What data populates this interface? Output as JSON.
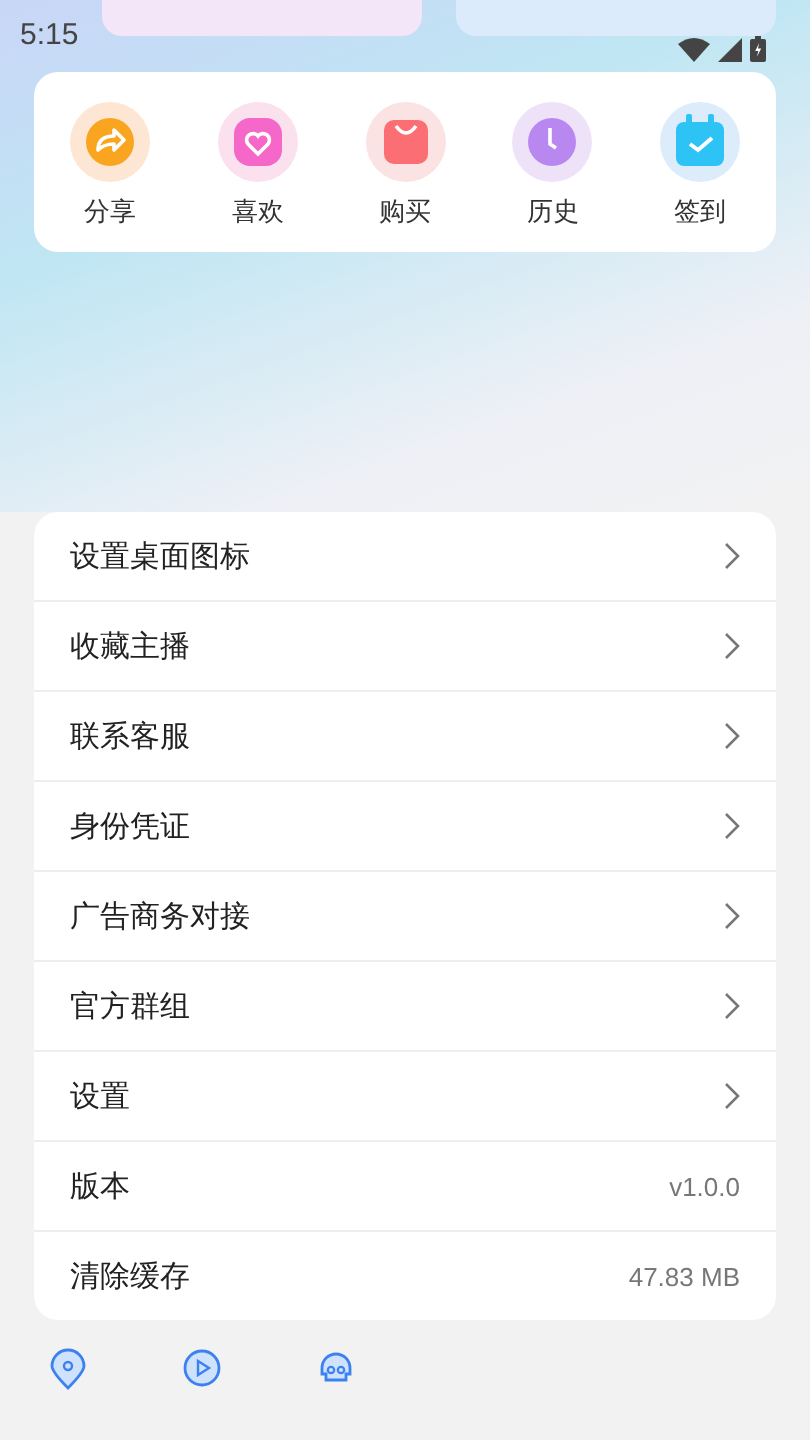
{
  "status_bar": {
    "time": "5:15"
  },
  "quick_actions": [
    {
      "label": "分享"
    },
    {
      "label": "喜欢"
    },
    {
      "label": "购买"
    },
    {
      "label": "历史"
    },
    {
      "label": "签到"
    }
  ],
  "menu": [
    {
      "label": "设置桌面图标",
      "kind": "link"
    },
    {
      "label": "收藏主播",
      "kind": "link"
    },
    {
      "label": "联系客服",
      "kind": "link"
    },
    {
      "label": "身份凭证",
      "kind": "link"
    },
    {
      "label": "广告商务对接",
      "kind": "link"
    },
    {
      "label": "官方群组",
      "kind": "link"
    },
    {
      "label": "设置",
      "kind": "link"
    },
    {
      "label": "版本",
      "kind": "value",
      "value": "v1.0.0"
    },
    {
      "label": "清除缓存",
      "kind": "value",
      "value": "47.83 MB"
    }
  ]
}
